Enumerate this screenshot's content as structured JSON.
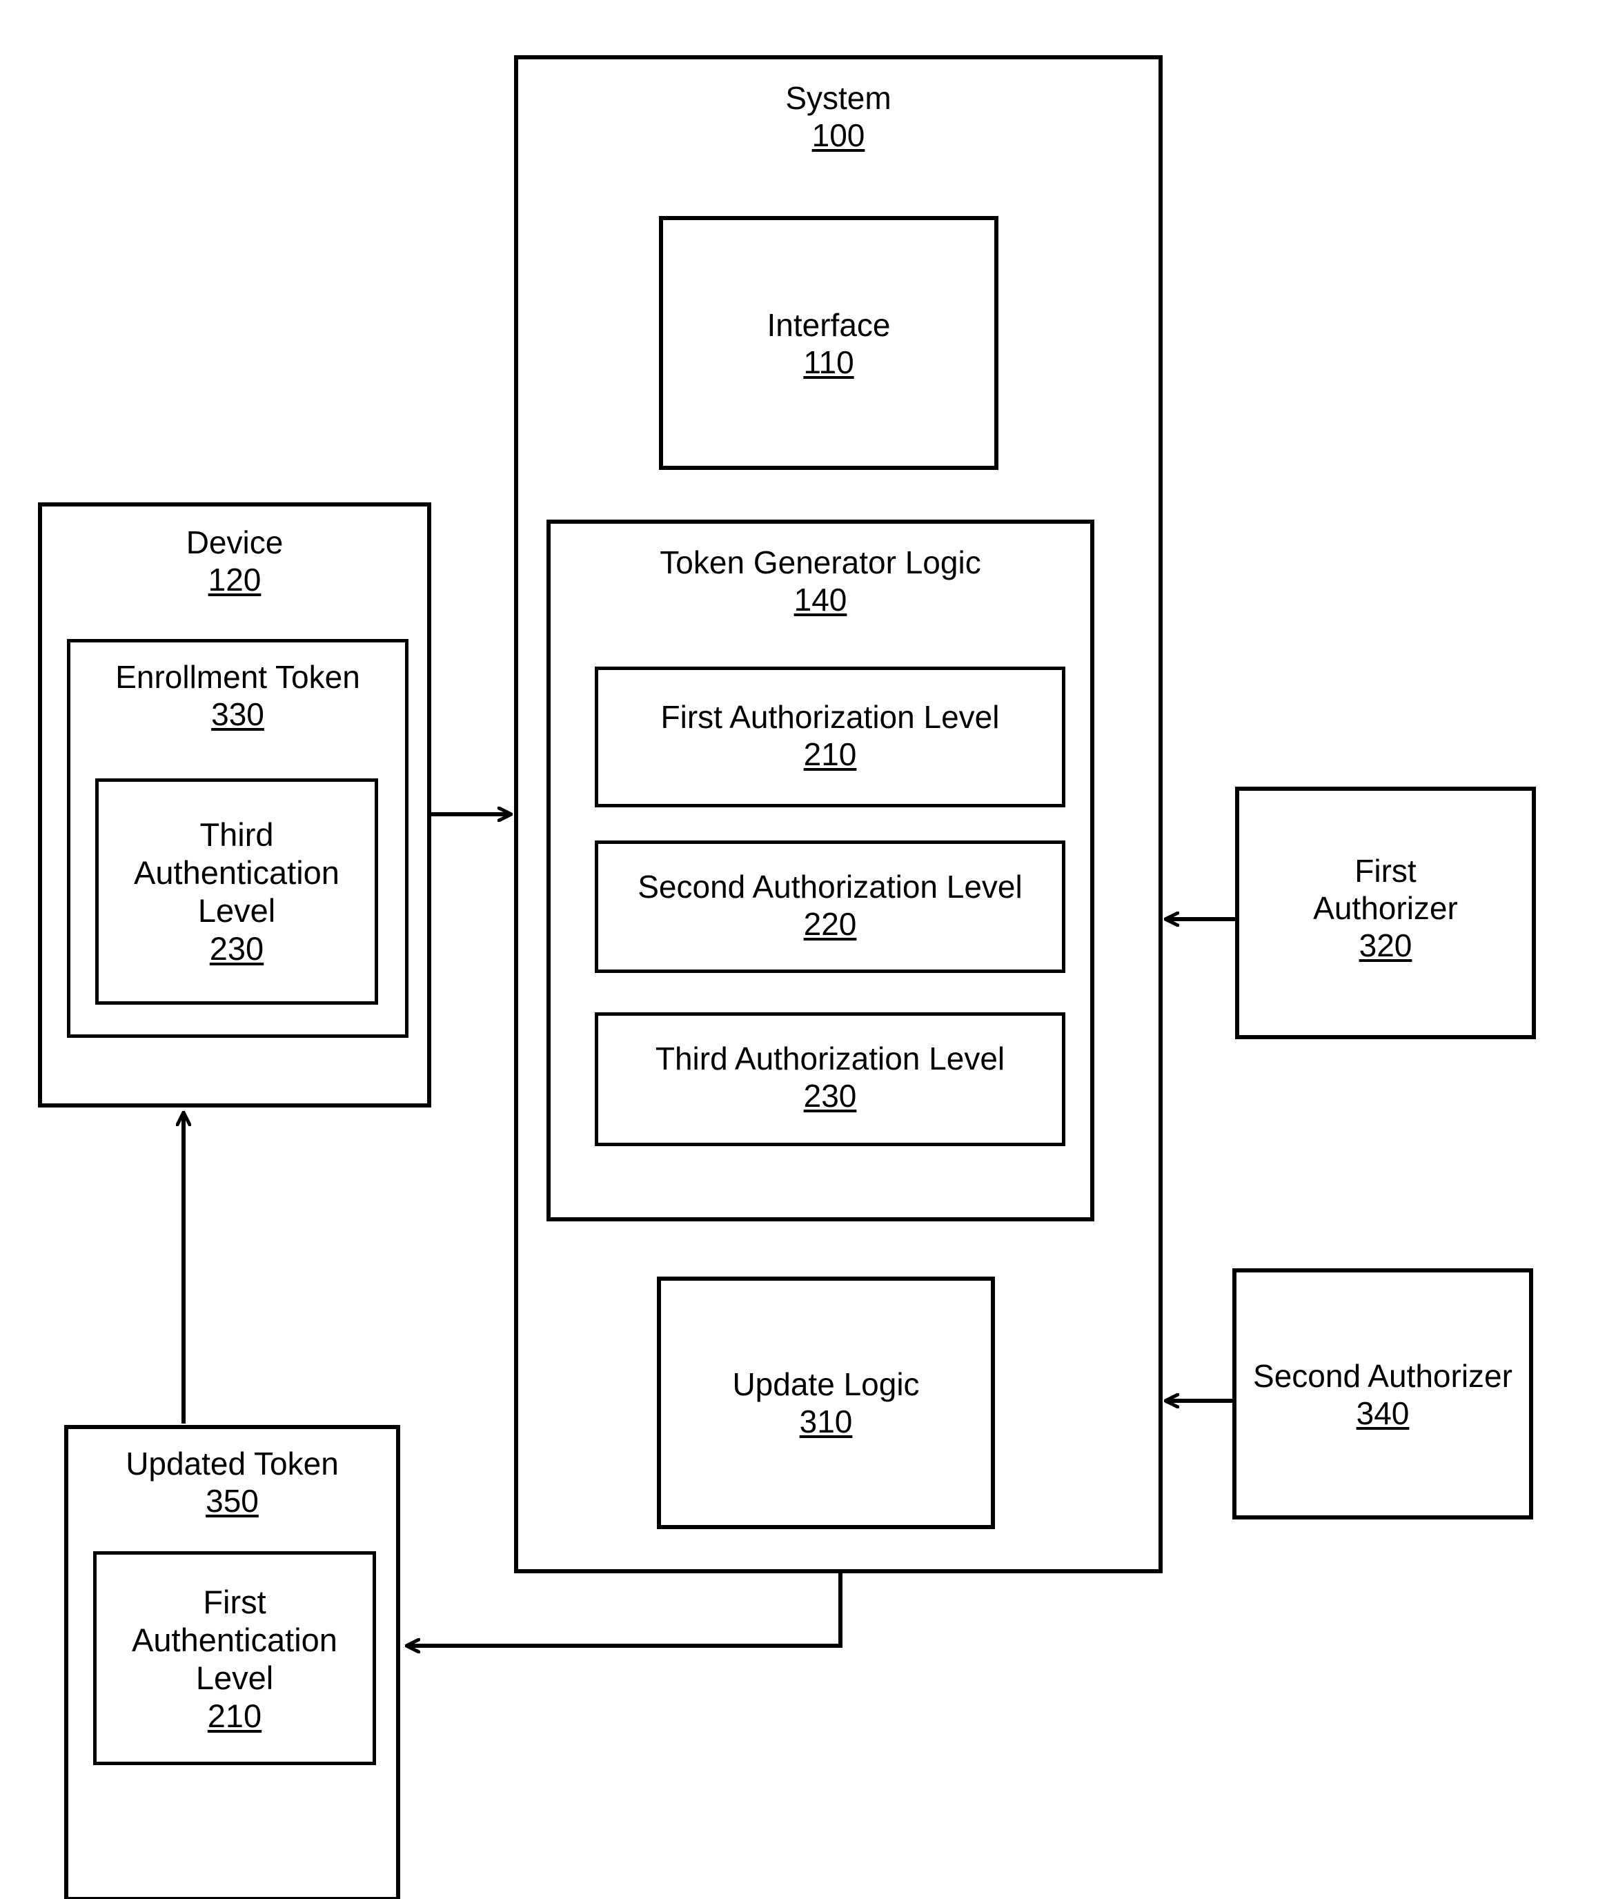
{
  "figure": {
    "type": "patent-block-diagram",
    "background_color": "#ffffff",
    "line_color": "#000000"
  },
  "blocks": {
    "system": {
      "title": "System",
      "ref": "100"
    },
    "interface": {
      "title": "Interface",
      "ref": "110"
    },
    "token_generator_logic": {
      "title": "Token Generator Logic",
      "ref": "140"
    },
    "first_auth_level": {
      "title": "First Authorization Level",
      "ref": "210"
    },
    "second_auth_level": {
      "title": "Second Authorization Level",
      "ref": "220"
    },
    "third_auth_level": {
      "title": "Third Authorization Level",
      "ref": "230"
    },
    "update_logic": {
      "title": "Update Logic",
      "ref": "310"
    },
    "device": {
      "title": "Device",
      "ref": "120"
    },
    "enrollment_token": {
      "title": "Enrollment Token",
      "ref": "330"
    },
    "third_authentication_level": {
      "title": "Third\nAuthentication\nLevel",
      "ref": "230"
    },
    "updated_token": {
      "title": "Updated Token",
      "ref": "350"
    },
    "first_authentication_level": {
      "title": "First\nAuthentication\nLevel",
      "ref": "210"
    },
    "first_authorizer": {
      "title": "First\nAuthorizer",
      "ref": "320"
    },
    "second_authorizer": {
      "title": "Second Authorizer",
      "ref": "340"
    }
  },
  "connectors": [
    {
      "name": "device-to-system",
      "from": "device",
      "to": "system",
      "direction": "right"
    },
    {
      "name": "first-authorizer-to-system",
      "from": "first_authorizer",
      "to": "system",
      "direction": "left"
    },
    {
      "name": "second-authorizer-to-system",
      "from": "second_authorizer",
      "to": "system",
      "direction": "left"
    },
    {
      "name": "system-to-updated-token",
      "from": "system",
      "to": "updated_token",
      "direction": "left"
    },
    {
      "name": "updated-token-to-device",
      "from": "updated_token",
      "to": "device",
      "direction": "up"
    }
  ]
}
